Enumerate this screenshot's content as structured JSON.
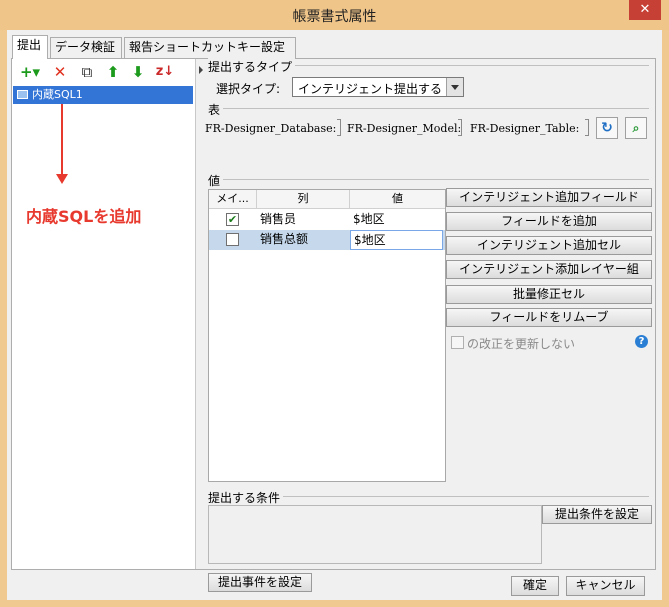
{
  "window": {
    "title": "帳票書式属性",
    "close_glyph": "✕"
  },
  "tabs": [
    {
      "label": "提出"
    },
    {
      "label": "データ検証"
    },
    {
      "label": "報告ショートカットキー設定"
    }
  ],
  "left_panel": {
    "toolbar": [
      {
        "icon": "add-dropdown-icon",
        "glyph": "+▾",
        "color": "#1c9a1c"
      },
      {
        "icon": "delete-icon",
        "glyph": "✕",
        "color": "#e0301e"
      },
      {
        "icon": "copy-icon",
        "glyph": "⧉",
        "color": "#333333"
      },
      {
        "icon": "move-up-icon",
        "glyph": "⬆",
        "color": "#1c9a1c"
      },
      {
        "icon": "move-down-icon",
        "glyph": "⬇",
        "color": "#1c9a1c"
      },
      {
        "icon": "sort-icon",
        "glyph": "z↓",
        "color": "#cc2a2a"
      }
    ],
    "tree_items": [
      {
        "label": "内蔵SQL1",
        "selected": true
      }
    ],
    "annotation": {
      "text": "内蔵SQLを追加",
      "color": "#e8392e"
    }
  },
  "submit_type": {
    "group_label": "提出するタイプ",
    "select_label": "選択タイプ:",
    "selected_value": "インテリジェント提出する"
  },
  "table_section": {
    "group_label": "表",
    "database": "FR-Designer_Database:",
    "model": "FR-Designer_Model:",
    "table": "FR-Designer_Table:",
    "refresh_icon": "refresh-icon",
    "preview_icon": "preview-icon"
  },
  "values_section": {
    "group_label": "値",
    "columns": [
      "メイ...",
      "列",
      "値"
    ],
    "rows": [
      {
        "checked": true,
        "check_glyph": "✔",
        "column": "销售员",
        "value": "$地区"
      },
      {
        "checked": false,
        "check_glyph": "",
        "column": "销售总额",
        "value": "$地区"
      }
    ],
    "buttons": [
      "インテリジェント追加フィールド",
      "フィールドを追加",
      "インテリジェント追加セル",
      "インテリジェント添加レイヤー組",
      "批量修正セル",
      "フィールドをリムーブ"
    ],
    "option": {
      "label": "の改正を更新しない",
      "checked": false
    },
    "help_glyph": "?"
  },
  "condition_section": {
    "group_label": "提出する条件",
    "set_condition_button": "提出条件を設定"
  },
  "event_button": "提出事件を設定",
  "footer": {
    "ok_button": "確定",
    "cancel_button": "キャンセル"
  }
}
